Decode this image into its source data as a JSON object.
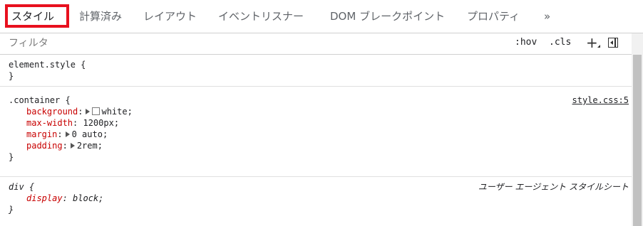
{
  "tabs": [
    {
      "label": "スタイル"
    },
    {
      "label": "計算済み"
    },
    {
      "label": "レイアウト"
    },
    {
      "label": "イベントリスナー"
    },
    {
      "label": "DOM ブレークポイント"
    },
    {
      "label": "プロパティ"
    },
    {
      "label": "»"
    }
  ],
  "filter": {
    "placeholder": "フィルタ",
    "hov": ":hov",
    "cls": ".cls",
    "plus": "+"
  },
  "rules": {
    "element_style": {
      "selector": "element.style {",
      "close": "}"
    },
    "container": {
      "selector": ".container {",
      "source": "style.css:5",
      "close": "}",
      "decls": [
        {
          "name": "background",
          "value": "white;"
        },
        {
          "name": "max-width",
          "value": "1200px;"
        },
        {
          "name": "margin",
          "value": "0 auto;"
        },
        {
          "name": "padding",
          "value": "2rem;"
        }
      ]
    },
    "div": {
      "selector": "div {",
      "source": "ユーザー エージェント スタイルシート",
      "close": "}",
      "decls": [
        {
          "name": "display",
          "value": "block;"
        }
      ]
    }
  },
  "colors": {
    "highlight": "#e8101e",
    "property_name": "#c80000"
  }
}
